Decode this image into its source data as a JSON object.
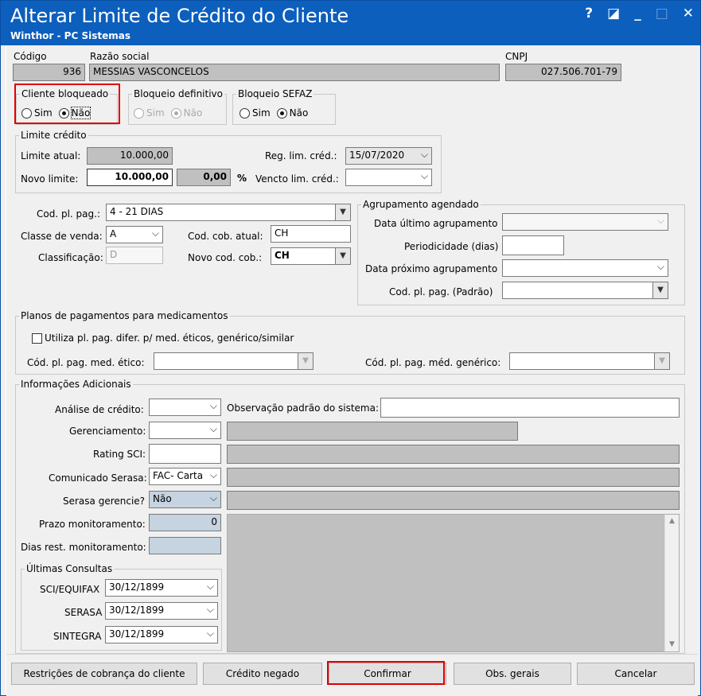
{
  "window": {
    "title": "Alterar Limite de Crédito do Cliente",
    "subtitle": "Winthor - PC Sistemas",
    "controls": {
      "help": "?",
      "restore": "◪",
      "minimize": "_",
      "maximize": "□",
      "close": "✕"
    }
  },
  "client": {
    "codigo_label": "Código",
    "codigo_value": "936",
    "razao_label": "Razão social",
    "razao_value": "MESSIAS VASCONCELOS",
    "cnpj_label": "CNPJ",
    "cnpj_value": "027.506.701-79"
  },
  "cliente_bloqueado": {
    "label": "Cliente bloqueado",
    "sim": "Sim",
    "nao": "Não",
    "selected": "Não"
  },
  "bloqueio_definitivo": {
    "label": "Bloqueio definitivo",
    "sim": "Sim",
    "nao": "Não",
    "selected": "Não"
  },
  "bloqueio_sefaz": {
    "label": "Bloqueio SEFAZ",
    "sim": "Sim",
    "nao": "Não",
    "selected": "Não"
  },
  "limite_credito": {
    "label": "Limite crédito",
    "atual_label": "Limite atual:",
    "atual_value": "10.000,00",
    "novo_label": "Novo limite:",
    "novo_value": "10.000,00",
    "percent_value": "0,00",
    "percent_sign": "%",
    "reg_label": "Reg. lim. créd.:",
    "reg_value": "15/07/2020",
    "vencto_label": "Vencto lim. créd.:",
    "vencto_value": ""
  },
  "pagamento": {
    "cod_pl_pag_label": "Cod. pl. pag.:",
    "cod_pl_pag_value": "4 - 21 DIAS",
    "classe_venda_label": "Classe de venda:",
    "classe_venda_value": "A",
    "classificacao_label": "Classificação:",
    "classificacao_value": "D",
    "cod_cob_atual_label": "Cod. cob. atual:",
    "cod_cob_atual_value": "CH",
    "novo_cod_cob_label": "Novo cod. cob.:",
    "novo_cod_cob_value": "CH"
  },
  "agrupamento": {
    "label": "Agrupamento agendado",
    "data_ultimo_label": "Data último agrupamento",
    "periodicidade_label": "Periodicidade (dias)",
    "data_proximo_label": "Data próximo agrupamento",
    "cod_pl_pag_padrao_label": "Cod. pl. pag. (Padrão)"
  },
  "medicamentos": {
    "label": "Planos de pagamentos para medicamentos",
    "checkbox_label": "Utiliza pl. pag. difer. p/ med. éticos, genérico/similar",
    "etico_label": "Cód. pl. pag. med. ético:",
    "generico_label": "Cód. pl. pag. méd. genérico:"
  },
  "info_adicionais": {
    "label": "Informações Adicionais",
    "analise_label": "Análise de crédito:",
    "analise_value": "",
    "observacao_label": "Observação padrão do sistema:",
    "gerenciamento_label": "Gerenciamento:",
    "rating_label": "Rating SCI:",
    "comunicado_label": "Comunicado Serasa:",
    "comunicado_value": "FAC- Carta",
    "serasa_gerencie_label": "Serasa gerencie?",
    "serasa_gerencie_value": "Não",
    "prazo_label": "Prazo monitoramento:",
    "prazo_value": "0",
    "dias_rest_label": "Dias rest. monitoramento:"
  },
  "ultimas_consultas": {
    "label": "Últimas Consultas",
    "sci_label": "SCI/EQUIFAX",
    "sci_value": "30/12/1899",
    "serasa_label": "SERASA",
    "serasa_value": "30/12/1899",
    "sintegra_label": "SINTEGRA",
    "sintegra_value": "30/12/1899"
  },
  "buttons": {
    "restricoes": "Restrições de cobrança do cliente",
    "credito_negado": "Crédito negado",
    "confirmar": "Confirmar",
    "obs_gerais": "Obs. gerais",
    "cancelar": "Cancelar"
  },
  "colors": {
    "titlebar": "#0c5fbd",
    "highlight": "#e00000",
    "readonly_gray": "#c0c0c0",
    "readonly_blue": "#c6d3e0"
  }
}
